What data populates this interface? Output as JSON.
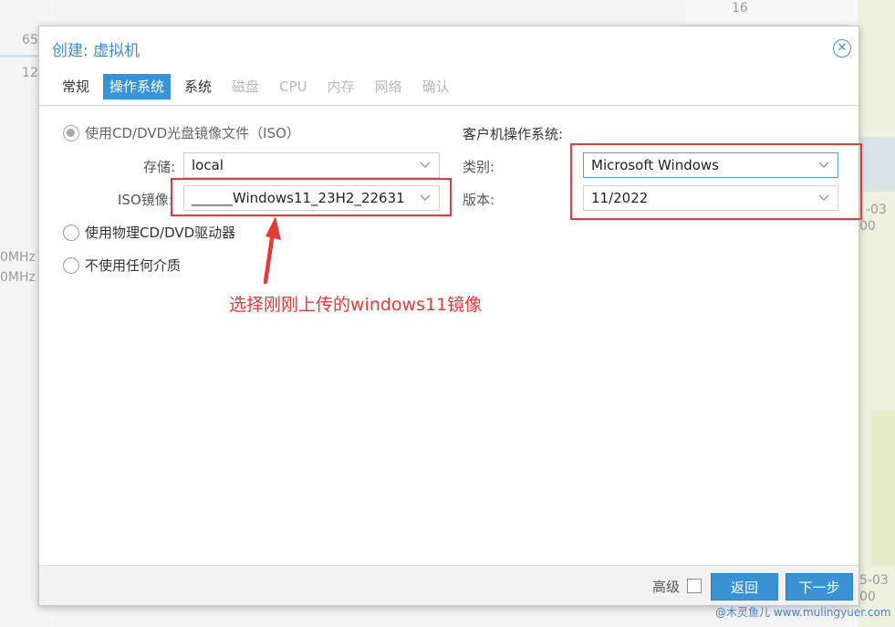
{
  "background": {
    "left_numbers": [
      "65",
      "12"
    ],
    "left_freq": [
      "0MHz",
      "0MHz"
    ],
    "top_axis": "16",
    "right_labels": [
      "-03",
      "00",
      "5-03",
      "00"
    ]
  },
  "dialog": {
    "title": "创建: 虚拟机",
    "tabs": [
      {
        "label": "常规",
        "state": "normal"
      },
      {
        "label": "操作系统",
        "state": "active"
      },
      {
        "label": "系统",
        "state": "normal"
      },
      {
        "label": "磁盘",
        "state": "disabled"
      },
      {
        "label": "CPU",
        "state": "disabled"
      },
      {
        "label": "内存",
        "state": "disabled"
      },
      {
        "label": "网络",
        "state": "disabled"
      },
      {
        "label": "确认",
        "state": "disabled"
      }
    ],
    "media": {
      "iso_option": "使用CD/DVD光盘镜像文件（ISO）",
      "storage_label": "存储:",
      "storage_value": "local",
      "iso_label": "ISO镜像:",
      "iso_value": "______Windows11_23H2_22631",
      "physical_option": "使用物理CD/DVD驱动器",
      "none_option": "不使用任何介质"
    },
    "guest_os": {
      "heading": "客户机操作系统:",
      "type_label": "类别:",
      "type_value": "Microsoft Windows",
      "version_label": "版本:",
      "version_value": "11/2022"
    },
    "annotation": "选择刚刚上传的windows11镜像",
    "footer": {
      "advanced_label": "高级",
      "back_label": "返回",
      "next_label": "下一步"
    }
  },
  "watermark": "@木灵鱼儿 www.mulingyuer.com",
  "colors": {
    "accent": "#3892d4",
    "annotation_red": "#e43a3a"
  },
  "icons": {
    "close": "circle-x",
    "dropdown": "chevron-down"
  }
}
